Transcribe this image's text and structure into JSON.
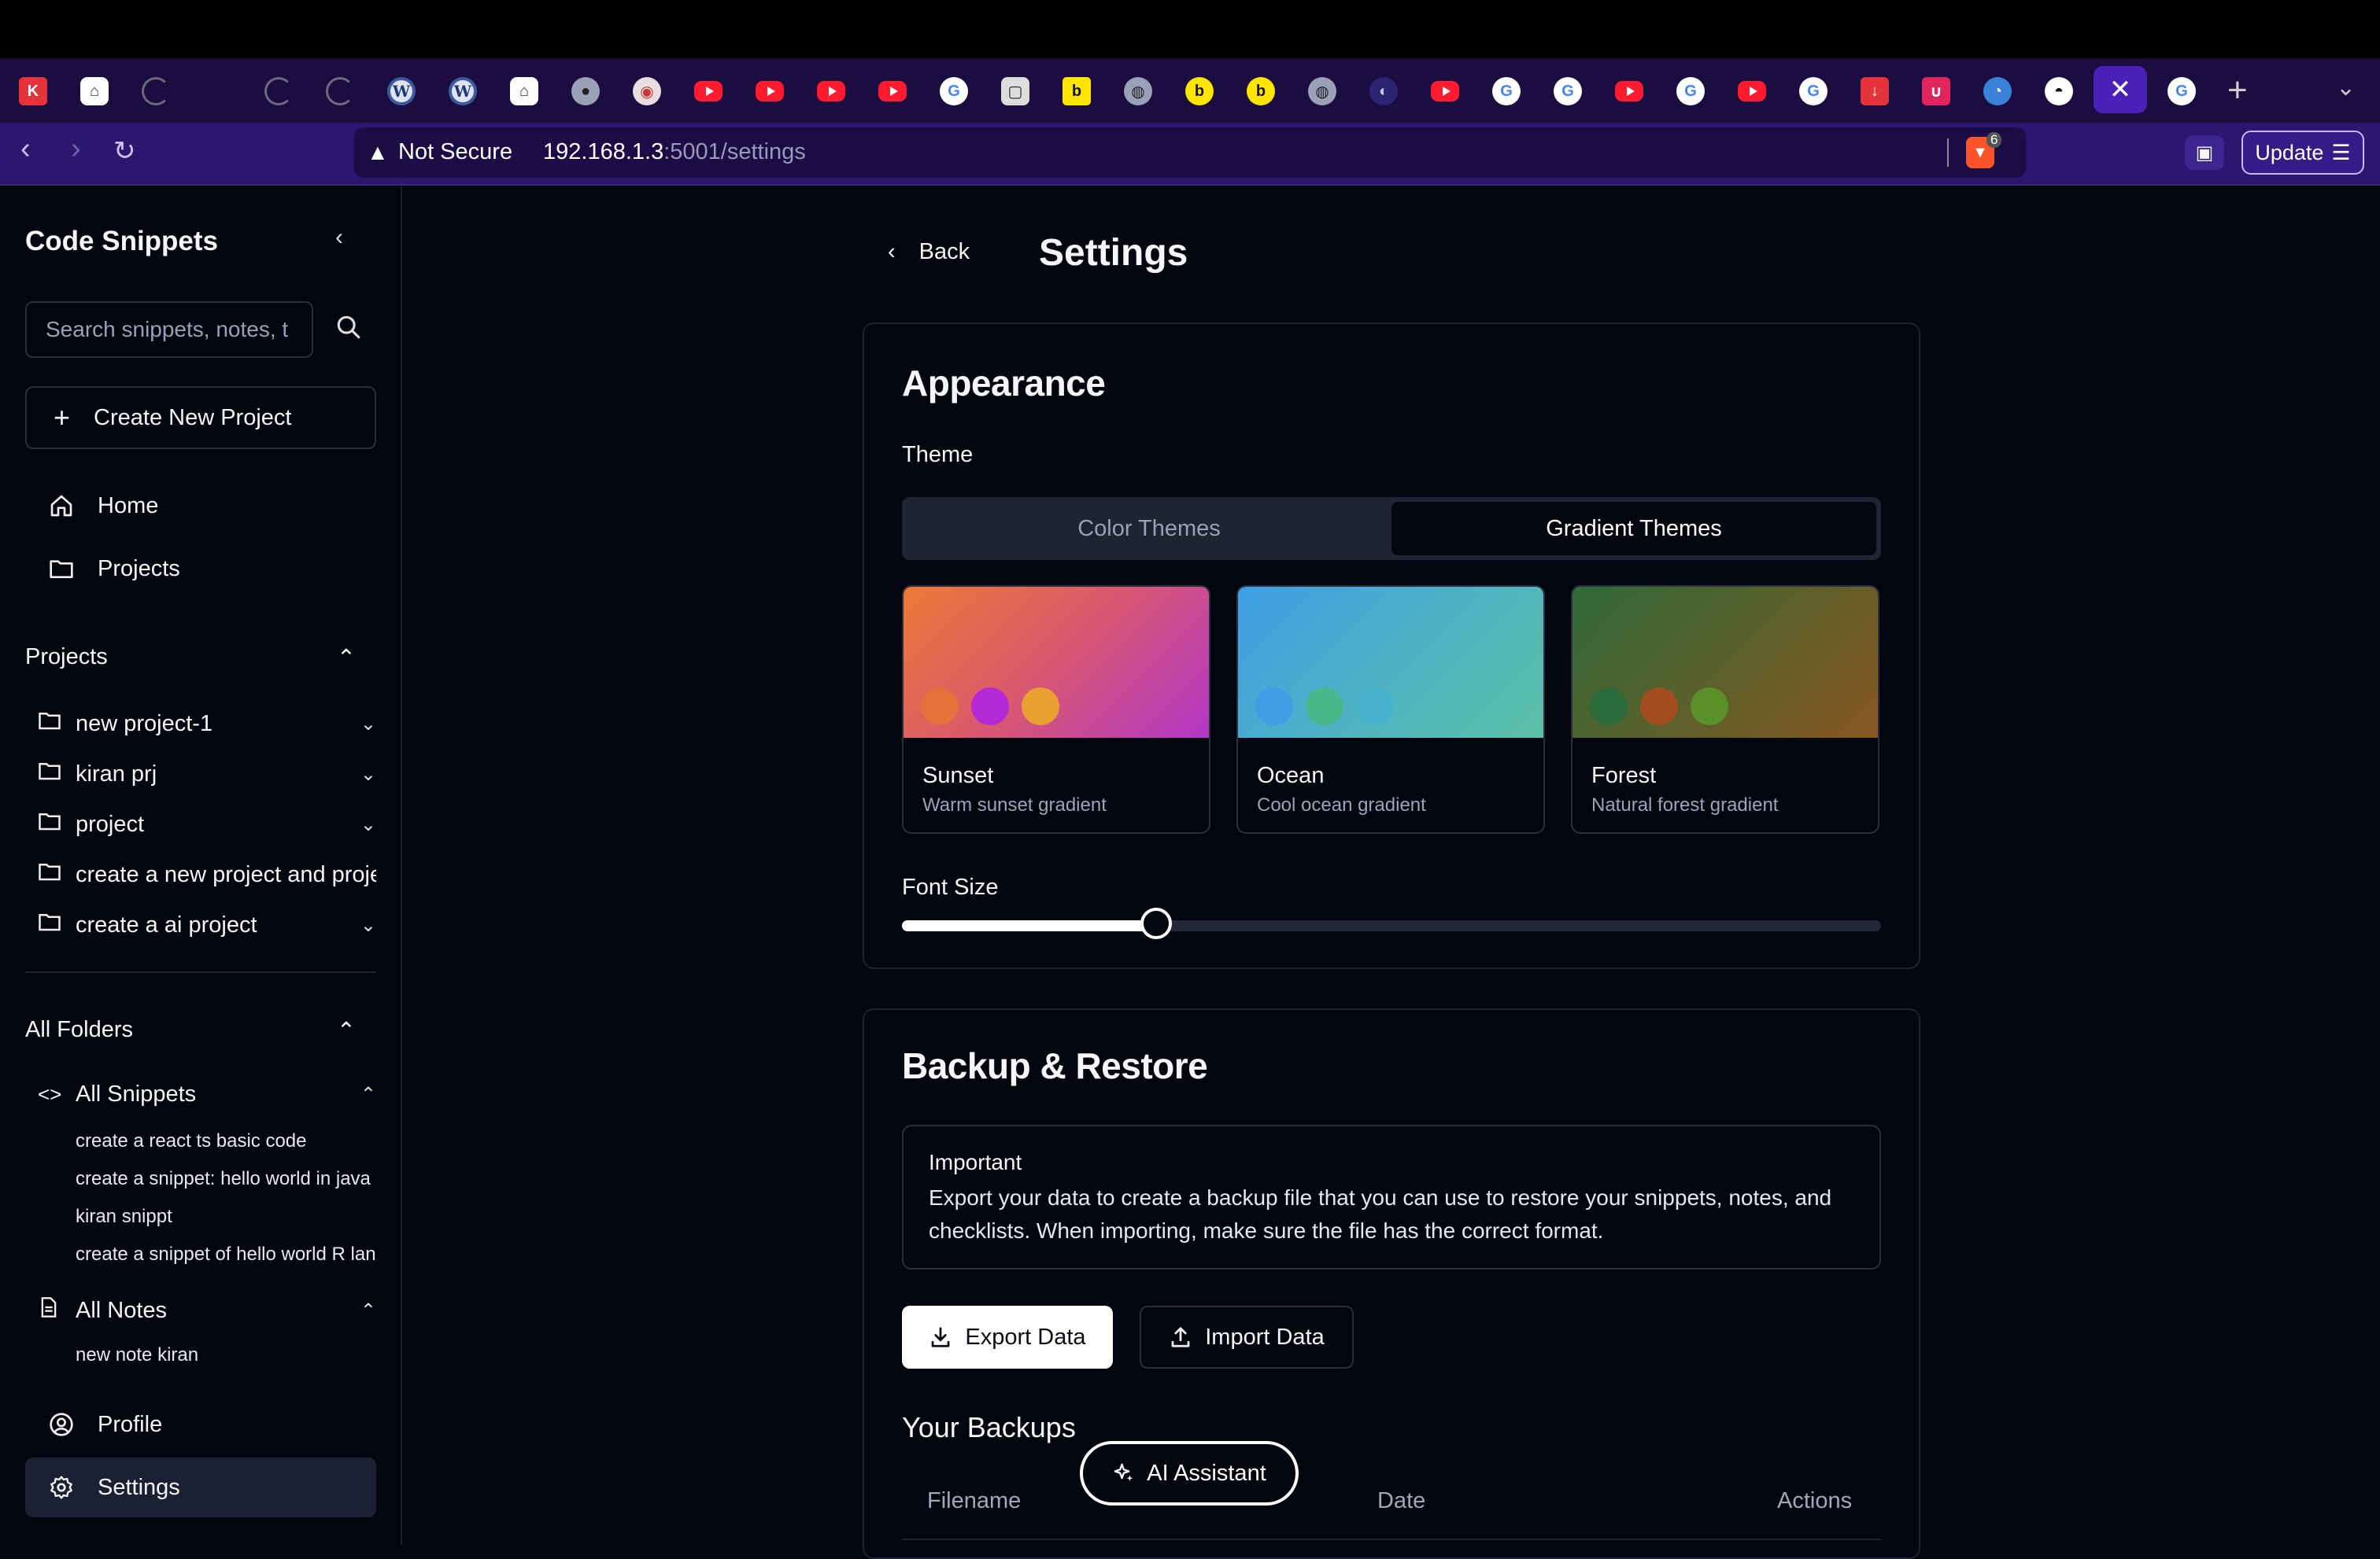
{
  "browser": {
    "address": {
      "not_secure_label": "Not Secure",
      "url_host": "192.168.1.3",
      "url_path": ":5001/settings"
    },
    "brave_badge": "6",
    "update_label": "Update"
  },
  "sidebar": {
    "title": "Code Snippets",
    "search_placeholder": "Search snippets, notes, t",
    "create_project_label": "Create New Project",
    "nav": [
      {
        "label": "Home",
        "icon": "home-icon"
      },
      {
        "label": "Projects",
        "icon": "folder-icon"
      }
    ],
    "projects_heading": "Projects",
    "projects": [
      {
        "label": "new project-1"
      },
      {
        "label": "kiran prj"
      },
      {
        "label": "project"
      },
      {
        "label": "create a new project and project description"
      },
      {
        "label": "create a ai project"
      }
    ],
    "all_folders_heading": "All Folders",
    "all_snippets_label": "All Snippets",
    "snippets": [
      {
        "label": "create a react ts basic code"
      },
      {
        "label": "create a snippet: hello world in java"
      },
      {
        "label": "kiran snippt"
      },
      {
        "label": "create a snippet of hello world R language"
      }
    ],
    "all_notes_label": "All Notes",
    "notes": [
      {
        "label": "new note kiran"
      }
    ],
    "profile_label": "Profile",
    "settings_label": "Settings"
  },
  "main": {
    "back_label": "Back",
    "page_title": "Settings",
    "appearance": {
      "title": "Appearance",
      "theme_label": "Theme",
      "tabs": [
        {
          "label": "Color Themes",
          "selected": false
        },
        {
          "label": "Gradient Themes",
          "selected": true
        }
      ],
      "themes": [
        {
          "name": "Sunset",
          "description": "Warm sunset gradient",
          "dot_colors": [
            "#e8703a",
            "#b52ad6",
            "#e8a030"
          ]
        },
        {
          "name": "Ocean",
          "description": "Cool ocean gradient",
          "dot_colors": [
            "#3f9ee4",
            "#48b88a",
            "#47b2cc"
          ]
        },
        {
          "name": "Forest",
          "description": "Natural forest gradient",
          "dot_colors": [
            "#2b6a3a",
            "#a24e1e",
            "#5a9028"
          ]
        }
      ],
      "font_size_label": "Font Size",
      "font_size_fraction": 0.26
    },
    "backup": {
      "title": "Backup & Restore",
      "important_title": "Important",
      "important_body": "Export your data to create a backup file that you can use to restore your snippets, notes, and checklists. When importing, make sure the file has the correct format.",
      "export_label": "Export Data",
      "import_label": "Import Data",
      "your_backups_label": "Your Backups",
      "columns": [
        "Filename",
        "Date",
        "Actions"
      ]
    },
    "ai_assistant_label": "AI Assistant"
  },
  "colors": {
    "background": "#03050f",
    "tabstrip": "#1b0d40",
    "addressbar": "#2b1670",
    "active_tab": "#4a21b8",
    "sidebar_active": "#1c2033"
  }
}
